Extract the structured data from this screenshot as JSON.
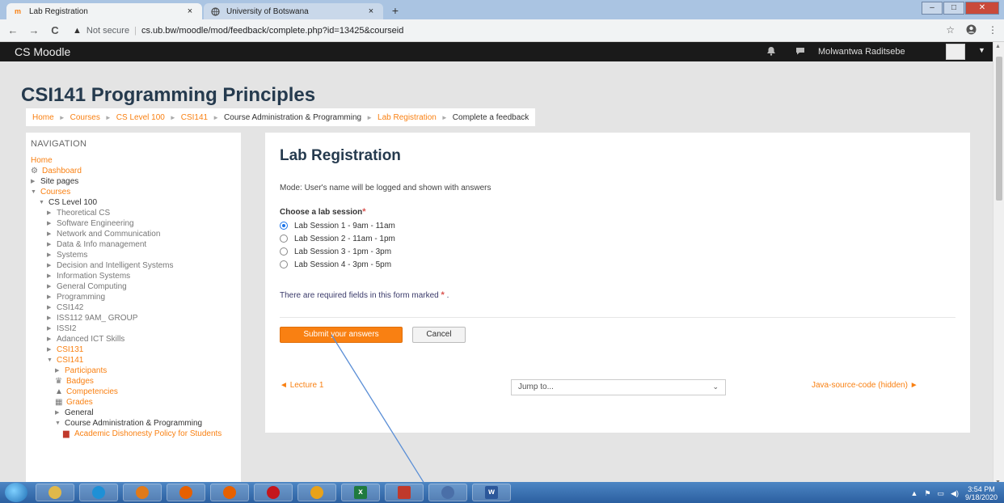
{
  "browser": {
    "tabs": [
      {
        "label": "Lab Registration",
        "icon": "moodle-icon",
        "close": "×"
      },
      {
        "label": "University of Botswana",
        "icon": "globe-icon",
        "close": "×"
      }
    ],
    "new_tab": "+",
    "back": "←",
    "forward": "→",
    "reload": "C",
    "security_label": "Not secure",
    "url": "cs.ub.bw/moodle/mod/feedback/complete.php?id=13425&courseid",
    "bookmark_star": "☆",
    "menu_dots": "⋮"
  },
  "moodle_bar": {
    "brand": "CS Moodle",
    "user_name": "Molwantwa Raditsebe"
  },
  "course": {
    "title": "CSI141 Programming Principles"
  },
  "breadcrumb": [
    {
      "label": "Home",
      "link": true
    },
    {
      "label": "Courses",
      "link": true
    },
    {
      "label": "CS Level 100",
      "link": true
    },
    {
      "label": "CSI141",
      "link": true
    },
    {
      "label": "Course Administration & Programming",
      "link": false
    },
    {
      "label": "Lab Registration",
      "link": true
    },
    {
      "label": "Complete a feedback",
      "link": false
    }
  ],
  "navigation": {
    "heading": "NAVIGATION",
    "items": [
      {
        "label": "Home",
        "style": "link",
        "indent": 0,
        "prefix": ""
      },
      {
        "label": "Dashboard",
        "style": "link",
        "indent": 0,
        "prefix": "dashboard-icon"
      },
      {
        "label": "Site pages",
        "style": "dark",
        "indent": 0,
        "prefix": "collapsed"
      },
      {
        "label": "Courses",
        "style": "link",
        "indent": 0,
        "prefix": "expanded"
      },
      {
        "label": "CS Level 100",
        "style": "dark",
        "indent": 1,
        "prefix": "expanded"
      },
      {
        "label": "Theoretical CS",
        "style": "grey",
        "indent": 2,
        "prefix": "collapsed"
      },
      {
        "label": "Software Engineering",
        "style": "grey",
        "indent": 2,
        "prefix": "collapsed"
      },
      {
        "label": "Network and Communication",
        "style": "grey",
        "indent": 2,
        "prefix": "collapsed"
      },
      {
        "label": "Data & Info management",
        "style": "grey",
        "indent": 2,
        "prefix": "collapsed"
      },
      {
        "label": "Systems",
        "style": "grey",
        "indent": 2,
        "prefix": "collapsed"
      },
      {
        "label": "Decision and Intelligent Systems",
        "style": "grey",
        "indent": 2,
        "prefix": "collapsed"
      },
      {
        "label": "Information Systems",
        "style": "grey",
        "indent": 2,
        "prefix": "collapsed"
      },
      {
        "label": "General Computing",
        "style": "grey",
        "indent": 2,
        "prefix": "collapsed"
      },
      {
        "label": "Programming",
        "style": "grey",
        "indent": 2,
        "prefix": "collapsed"
      },
      {
        "label": "CSI142",
        "style": "grey",
        "indent": 2,
        "prefix": "collapsed"
      },
      {
        "label": "ISS112 9AM_ GROUP",
        "style": "grey",
        "indent": 2,
        "prefix": "collapsed"
      },
      {
        "label": "ISSI2",
        "style": "grey",
        "indent": 2,
        "prefix": "collapsed"
      },
      {
        "label": "Adanced ICT Skills",
        "style": "grey",
        "indent": 2,
        "prefix": "collapsed"
      },
      {
        "label": "CSI131",
        "style": "link",
        "indent": 2,
        "prefix": "collapsed"
      },
      {
        "label": "CSI141",
        "style": "link",
        "indent": 2,
        "prefix": "expanded"
      },
      {
        "label": "Participants",
        "style": "link",
        "indent": 3,
        "prefix": "collapsed"
      },
      {
        "label": "Badges",
        "style": "link",
        "indent": 3,
        "prefix": "badge-icon"
      },
      {
        "label": "Competencies",
        "style": "link",
        "indent": 3,
        "prefix": "competency-icon"
      },
      {
        "label": "Grades",
        "style": "link",
        "indent": 3,
        "prefix": "grades-icon"
      },
      {
        "label": "General",
        "style": "dark",
        "indent": 3,
        "prefix": "collapsed"
      },
      {
        "label": "Course Administration & Programming",
        "style": "dark",
        "indent": 3,
        "prefix": "expanded"
      },
      {
        "label": "Academic Dishonesty Policy for Students",
        "style": "link",
        "indent": 4,
        "prefix": "pdf-icon"
      }
    ]
  },
  "form": {
    "title": "Lab Registration",
    "mode_text": "Mode: User's name will be logged and shown with answers",
    "question": "Choose a lab session",
    "options": [
      {
        "label": "Lab Session 1 - 9am - 11am",
        "checked": true
      },
      {
        "label": "Lab Session 2 - 11am - 1pm",
        "checked": false
      },
      {
        "label": "Lab Session 3 - 1pm - 3pm",
        "checked": false
      },
      {
        "label": "Lab Session 4 - 3pm - 5pm",
        "checked": false
      }
    ],
    "required_note": "There are required fields in this form marked",
    "required_note_end": ".",
    "submit_label": "Submit your answers",
    "cancel_label": "Cancel",
    "prev_link": "Lecture 1",
    "jump_placeholder": "Jump to...",
    "next_link": "Java-source-code (hidden)"
  },
  "taskbar": {
    "apps": [
      "explorer-icon",
      "ie-icon",
      "media-icon",
      "firefox-icon",
      "firefox-alt-icon",
      "opera-icon",
      "chrome-icon",
      "excel-icon",
      "acrobat-icon",
      "network-icon",
      "word-icon"
    ],
    "excel_label": "x",
    "word_label": "w",
    "clock_time": "3:54 PM",
    "clock_date": "9/18/2020"
  },
  "colors": {
    "accent": "#f98012",
    "title": "#253a4e",
    "moodle_bar": "#1a1a1a",
    "required_star": "#d9534f"
  }
}
